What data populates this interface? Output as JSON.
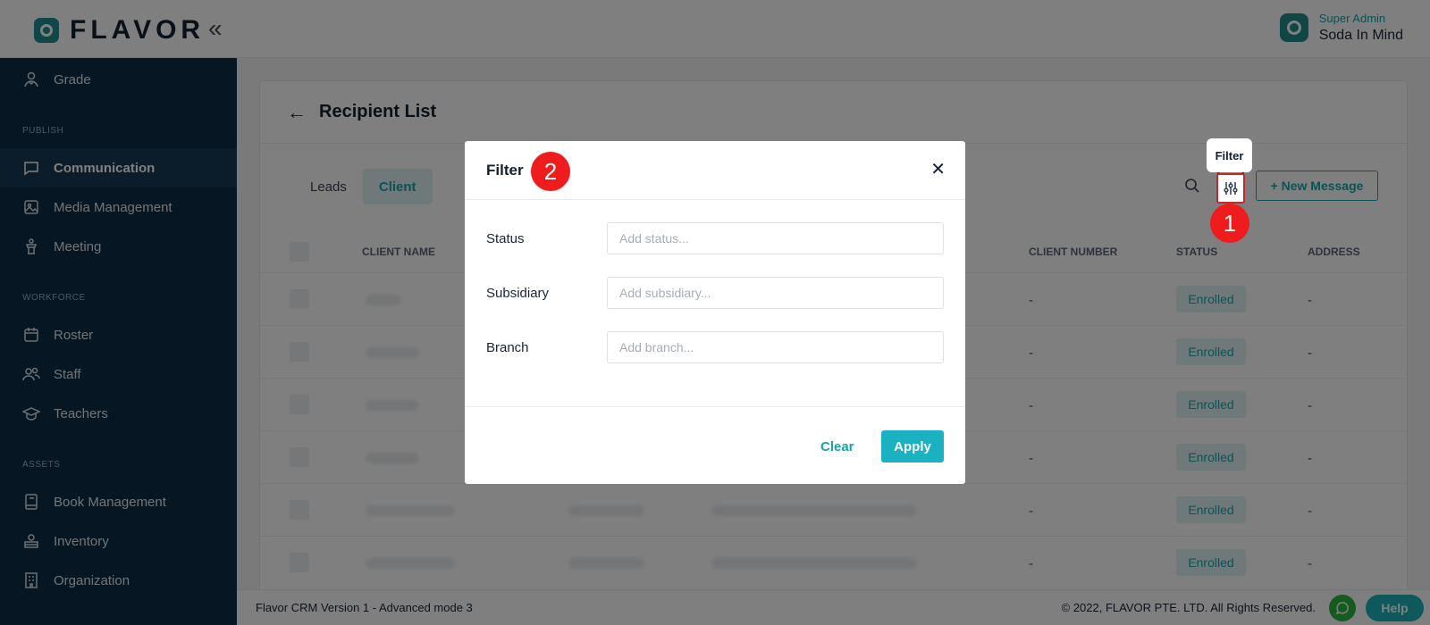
{
  "app": {
    "logo_text": "FLAVOR",
    "collapse_glyph": "«"
  },
  "user": {
    "role": "Super Admin",
    "name": "Soda In Mind"
  },
  "sidebar": {
    "items": [
      {
        "label": "Grade",
        "icon": "graduate-icon"
      },
      {
        "label": "Communication",
        "icon": "chat-icon"
      },
      {
        "label": "Media Management",
        "icon": "image-icon"
      },
      {
        "label": "Meeting",
        "icon": "podium-icon"
      },
      {
        "label": "Roster",
        "icon": "calendar-icon"
      },
      {
        "label": "Staff",
        "icon": "users-icon"
      },
      {
        "label": "Teachers",
        "icon": "cap-icon"
      },
      {
        "label": "Book Management",
        "icon": "book-icon"
      },
      {
        "label": "Inventory",
        "icon": "box-icon"
      },
      {
        "label": "Organization",
        "icon": "building-icon"
      }
    ],
    "sections": {
      "publish": "PUBLISH",
      "workforce": "WORKFORCE",
      "assets": "ASSETS"
    },
    "active": "Communication"
  },
  "page": {
    "title": "Recipient List",
    "tabs": [
      "Leads",
      "Client"
    ],
    "active_tab": "Client",
    "new_message_label": "+ New Message",
    "filter_tooltip": "Filter"
  },
  "table": {
    "columns": [
      "CLIENT NAME",
      "CLIENT NUMBER",
      "STATUS",
      "ADDRESS"
    ],
    "rows": [
      {
        "client_number": "-",
        "status": "Enrolled",
        "address": "-"
      },
      {
        "client_number": "-",
        "status": "Enrolled",
        "address": "-"
      },
      {
        "client_number": "-",
        "status": "Enrolled",
        "address": "-"
      },
      {
        "client_number": "-",
        "status": "Enrolled",
        "address": "-"
      },
      {
        "client_number": "-",
        "status": "Enrolled",
        "address": "-"
      },
      {
        "client_number": "-",
        "status": "Enrolled",
        "address": "-"
      }
    ]
  },
  "modal": {
    "title": "Filter",
    "fields": [
      {
        "label": "Status",
        "placeholder": "Add status..."
      },
      {
        "label": "Subsidiary",
        "placeholder": "Add subsidiary..."
      },
      {
        "label": "Branch",
        "placeholder": "Add branch..."
      }
    ],
    "clear_label": "Clear",
    "apply_label": "Apply"
  },
  "annotations": {
    "step1": "1",
    "step2": "2"
  },
  "footer": {
    "version": "Flavor CRM Version 1 - Advanced mode 3",
    "copyright": "© 2022, FLAVOR PTE. LTD. All Rights Reserved.",
    "help_label": "Help"
  },
  "colors": {
    "accent": "#1aa4a8",
    "sidebar": "#0d2e47",
    "highlight": "#c5282c",
    "step": "#ee1c1c"
  }
}
